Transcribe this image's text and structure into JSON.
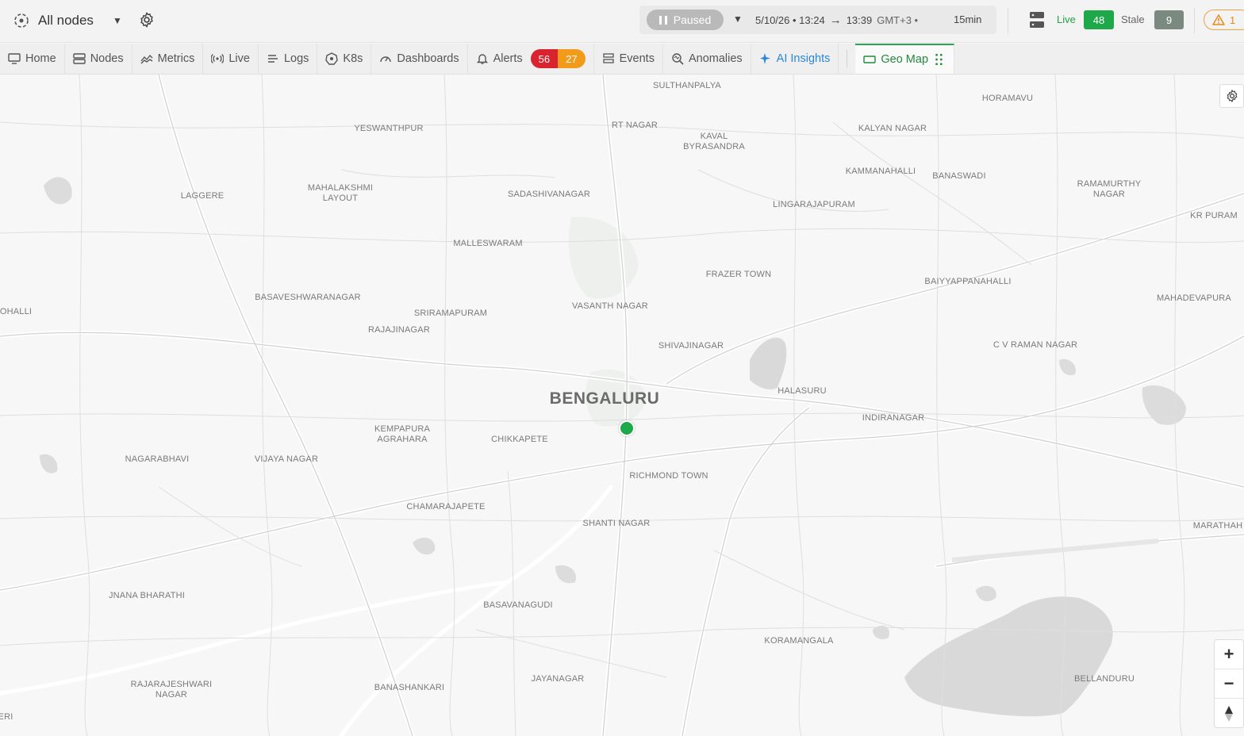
{
  "header": {
    "node_selector": "All nodes",
    "paused_label": "Paused",
    "range_start": "5/10/26 • 13:24",
    "range_arrow": "→",
    "range_end": "13:39",
    "timezone": "GMT+3 •",
    "duration": "15min",
    "live_label": "Live",
    "live_count": "48",
    "stale_label": "Stale",
    "stale_count": "9",
    "warning_count": "1"
  },
  "nav": {
    "tabs": [
      {
        "label": "Home",
        "icon": "monitor-icon"
      },
      {
        "label": "Nodes",
        "icon": "server-icon"
      },
      {
        "label": "Metrics",
        "icon": "metrics-icon"
      },
      {
        "label": "Live",
        "icon": "broadcast-icon"
      },
      {
        "label": "Logs",
        "icon": "logs-icon"
      },
      {
        "label": "K8s",
        "icon": "kubernetes-icon"
      },
      {
        "label": "Dashboards",
        "icon": "gauge-icon"
      },
      {
        "label": "Alerts",
        "icon": "bell-icon"
      },
      {
        "label": "Events",
        "icon": "events-icon"
      },
      {
        "label": "Anomalies",
        "icon": "anomaly-icon"
      },
      {
        "label": "AI Insights",
        "icon": "sparkle-icon"
      },
      {
        "label": "Geo Map",
        "icon": "map-icon"
      }
    ],
    "alerts_critical": "56",
    "alerts_warning": "27"
  },
  "map": {
    "city": "BENGALURU",
    "places": [
      "SULTHANPALYA",
      "HORAMAVU",
      "RT NAGAR",
      "KAVAL\nBYRASANDRA",
      "YESWANTHPUR",
      "KALYAN NAGAR",
      "KAMMANAHALLI",
      "BANASWADI",
      "RAMAMURTHY\nNAGAR",
      "MAHALAKSHMI\nLAYOUT",
      "LAGGERE",
      "SADASHIVANAGAR",
      "LINGARAJAPURAM",
      "KR PURAM",
      "MALLESWARAM",
      "FRAZER TOWN",
      "BAIYYAPPANAHALLI",
      "BASAVESHWARANAGAR",
      "VASANTH NAGAR",
      "SRIRAMAPURAM",
      "MAHADEVAPURA",
      "OHALLI",
      "RAJAJINAGAR",
      "SHIVAJINAGAR",
      "C V RAMAN NAGAR",
      "HALASURU",
      "INDIRANAGAR",
      "KEMPAPURA\nAGRAHARA",
      "CHIKKAPETE",
      "NAGARABHAVI",
      "VIJAYA NAGAR",
      "RICHMOND TOWN",
      "CHAMARAJAPETE",
      "SHANTI NAGAR",
      "MARATHAH",
      "JNANA BHARATHI",
      "BASAVANAGUDI",
      "KORAMANGALA",
      "RAJARAJESHWARI\nNAGAR",
      "BANASHANKARI",
      "JAYANAGAR",
      "BELLANDURU",
      "ERI"
    ],
    "zoom_in": "+",
    "zoom_out": "−",
    "compass": "▲"
  },
  "colors": {
    "live": "#1fa84a",
    "stale": "#7b8a80",
    "alert_red": "#d9232e",
    "alert_orange": "#f29a1a",
    "active_tab": "#1e8a3c",
    "ai": "#2b86d9",
    "node_marker": "#1da84a"
  }
}
